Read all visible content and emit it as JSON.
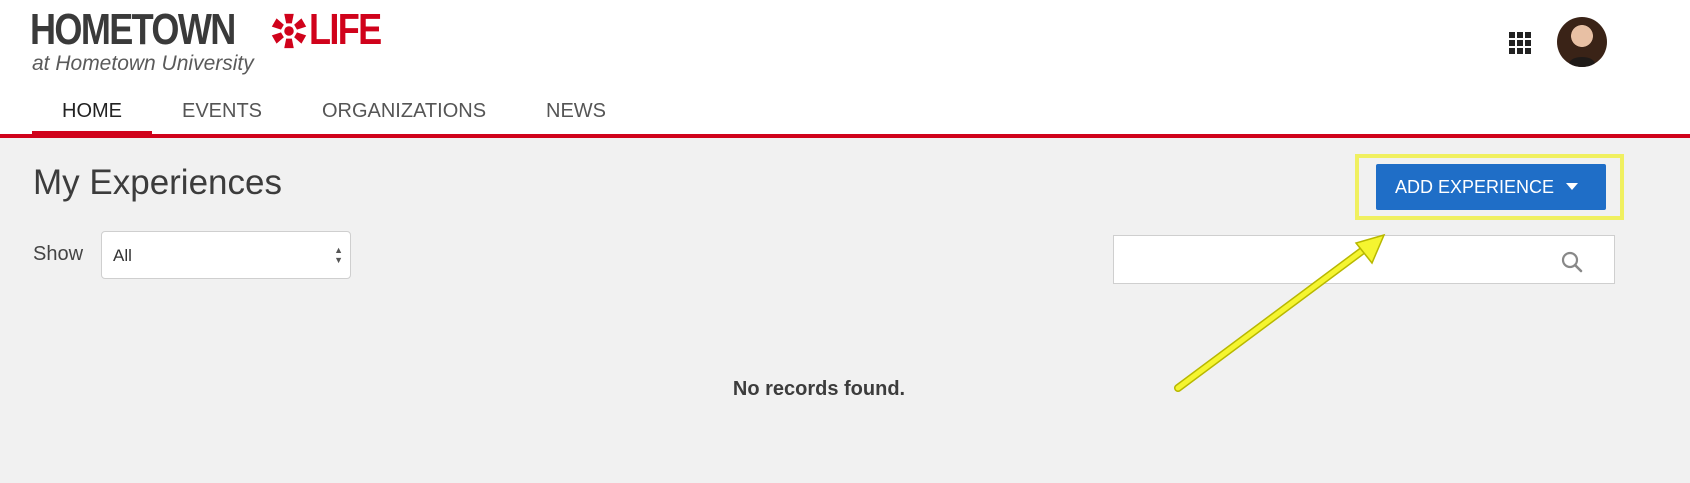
{
  "logo": {
    "word1": "HOMETOWN",
    "word2": "LIFE",
    "subtitle": "at Hometown University",
    "icon": "burst-logo-icon"
  },
  "nav": {
    "tabs": [
      {
        "label": "HOME",
        "active": true
      },
      {
        "label": "EVENTS",
        "active": false
      },
      {
        "label": "ORGANIZATIONS",
        "active": false
      },
      {
        "label": "NEWS",
        "active": false
      }
    ]
  },
  "header_icons": {
    "apps": "apps-grid-icon",
    "profile": "avatar"
  },
  "main": {
    "title": "My Experiences",
    "filter": {
      "label": "Show",
      "selected": "All"
    },
    "add_button": {
      "label": "ADD EXPERIENCE",
      "icon": "caret-down-icon"
    },
    "search": {
      "placeholder": "",
      "value": "",
      "icon": "search-icon"
    },
    "empty_message": "No records found."
  },
  "colors": {
    "accent": "#d0021b",
    "button": "#1f6ec7",
    "highlight": "#f0f060",
    "background": "#f1f1f1"
  }
}
